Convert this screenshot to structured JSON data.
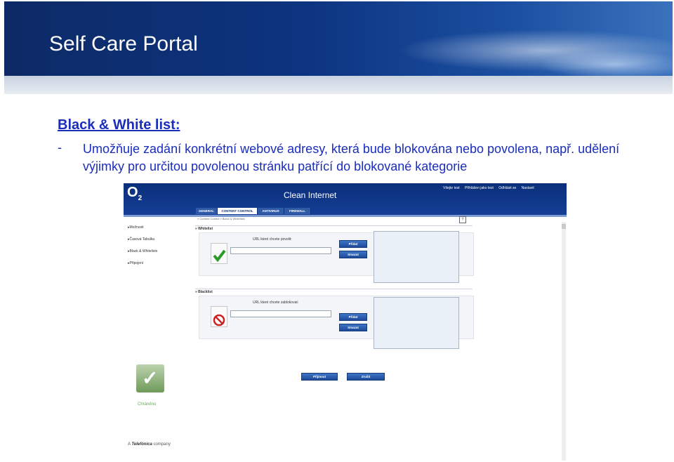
{
  "slide": {
    "title": "Self Care Portal",
    "heading": "Black & White list:",
    "bullet_marker": "-",
    "bullet_text": "Umožňuje zadání konkrétní webové adresy, která bude blokována nebo povolena, např. udělení výjimky pro určitou povolenou stránku patřící do blokované kategorie"
  },
  "app": {
    "logo": "O",
    "logo_sub": "2",
    "name": "Clean Internet",
    "user_info": [
      "Vítejte test",
      "Přihlášen jako test",
      "Odhlásit se",
      "Nastavit"
    ],
    "tabs": [
      "GENERAL",
      "CONTENT CONTROL",
      "ANTIVIRUS",
      "FIREWALL"
    ],
    "active_tab": "CONTENT CONTROL",
    "sidebar": [
      "Možnosti",
      "Časová Tabulka",
      "Black & Whitelists",
      "Připojení"
    ],
    "breadcrumb": "» Content Control » Black & Whitelists",
    "help_glyph": "?",
    "whitelist": {
      "header": "» Whitelist",
      "label": "URL které chcete povolit:",
      "add_button": "Přidat",
      "delete_button": "Smazat"
    },
    "blacklist": {
      "header": "» Blacklist",
      "label": "URL které chcete zablokovat:",
      "add_button": "Přidat",
      "delete_button": "Smazat"
    },
    "accept_button": "Přijmout",
    "cancel_button": "Zrušit",
    "status_label": "Chráněno",
    "company_prefix": "A",
    "company_brand": "Telefónica",
    "company_suffix": "company",
    "colors": {
      "header": "#0a2e7a",
      "button": "#2b5fb2",
      "text_blue": "#1a2dbd"
    }
  }
}
